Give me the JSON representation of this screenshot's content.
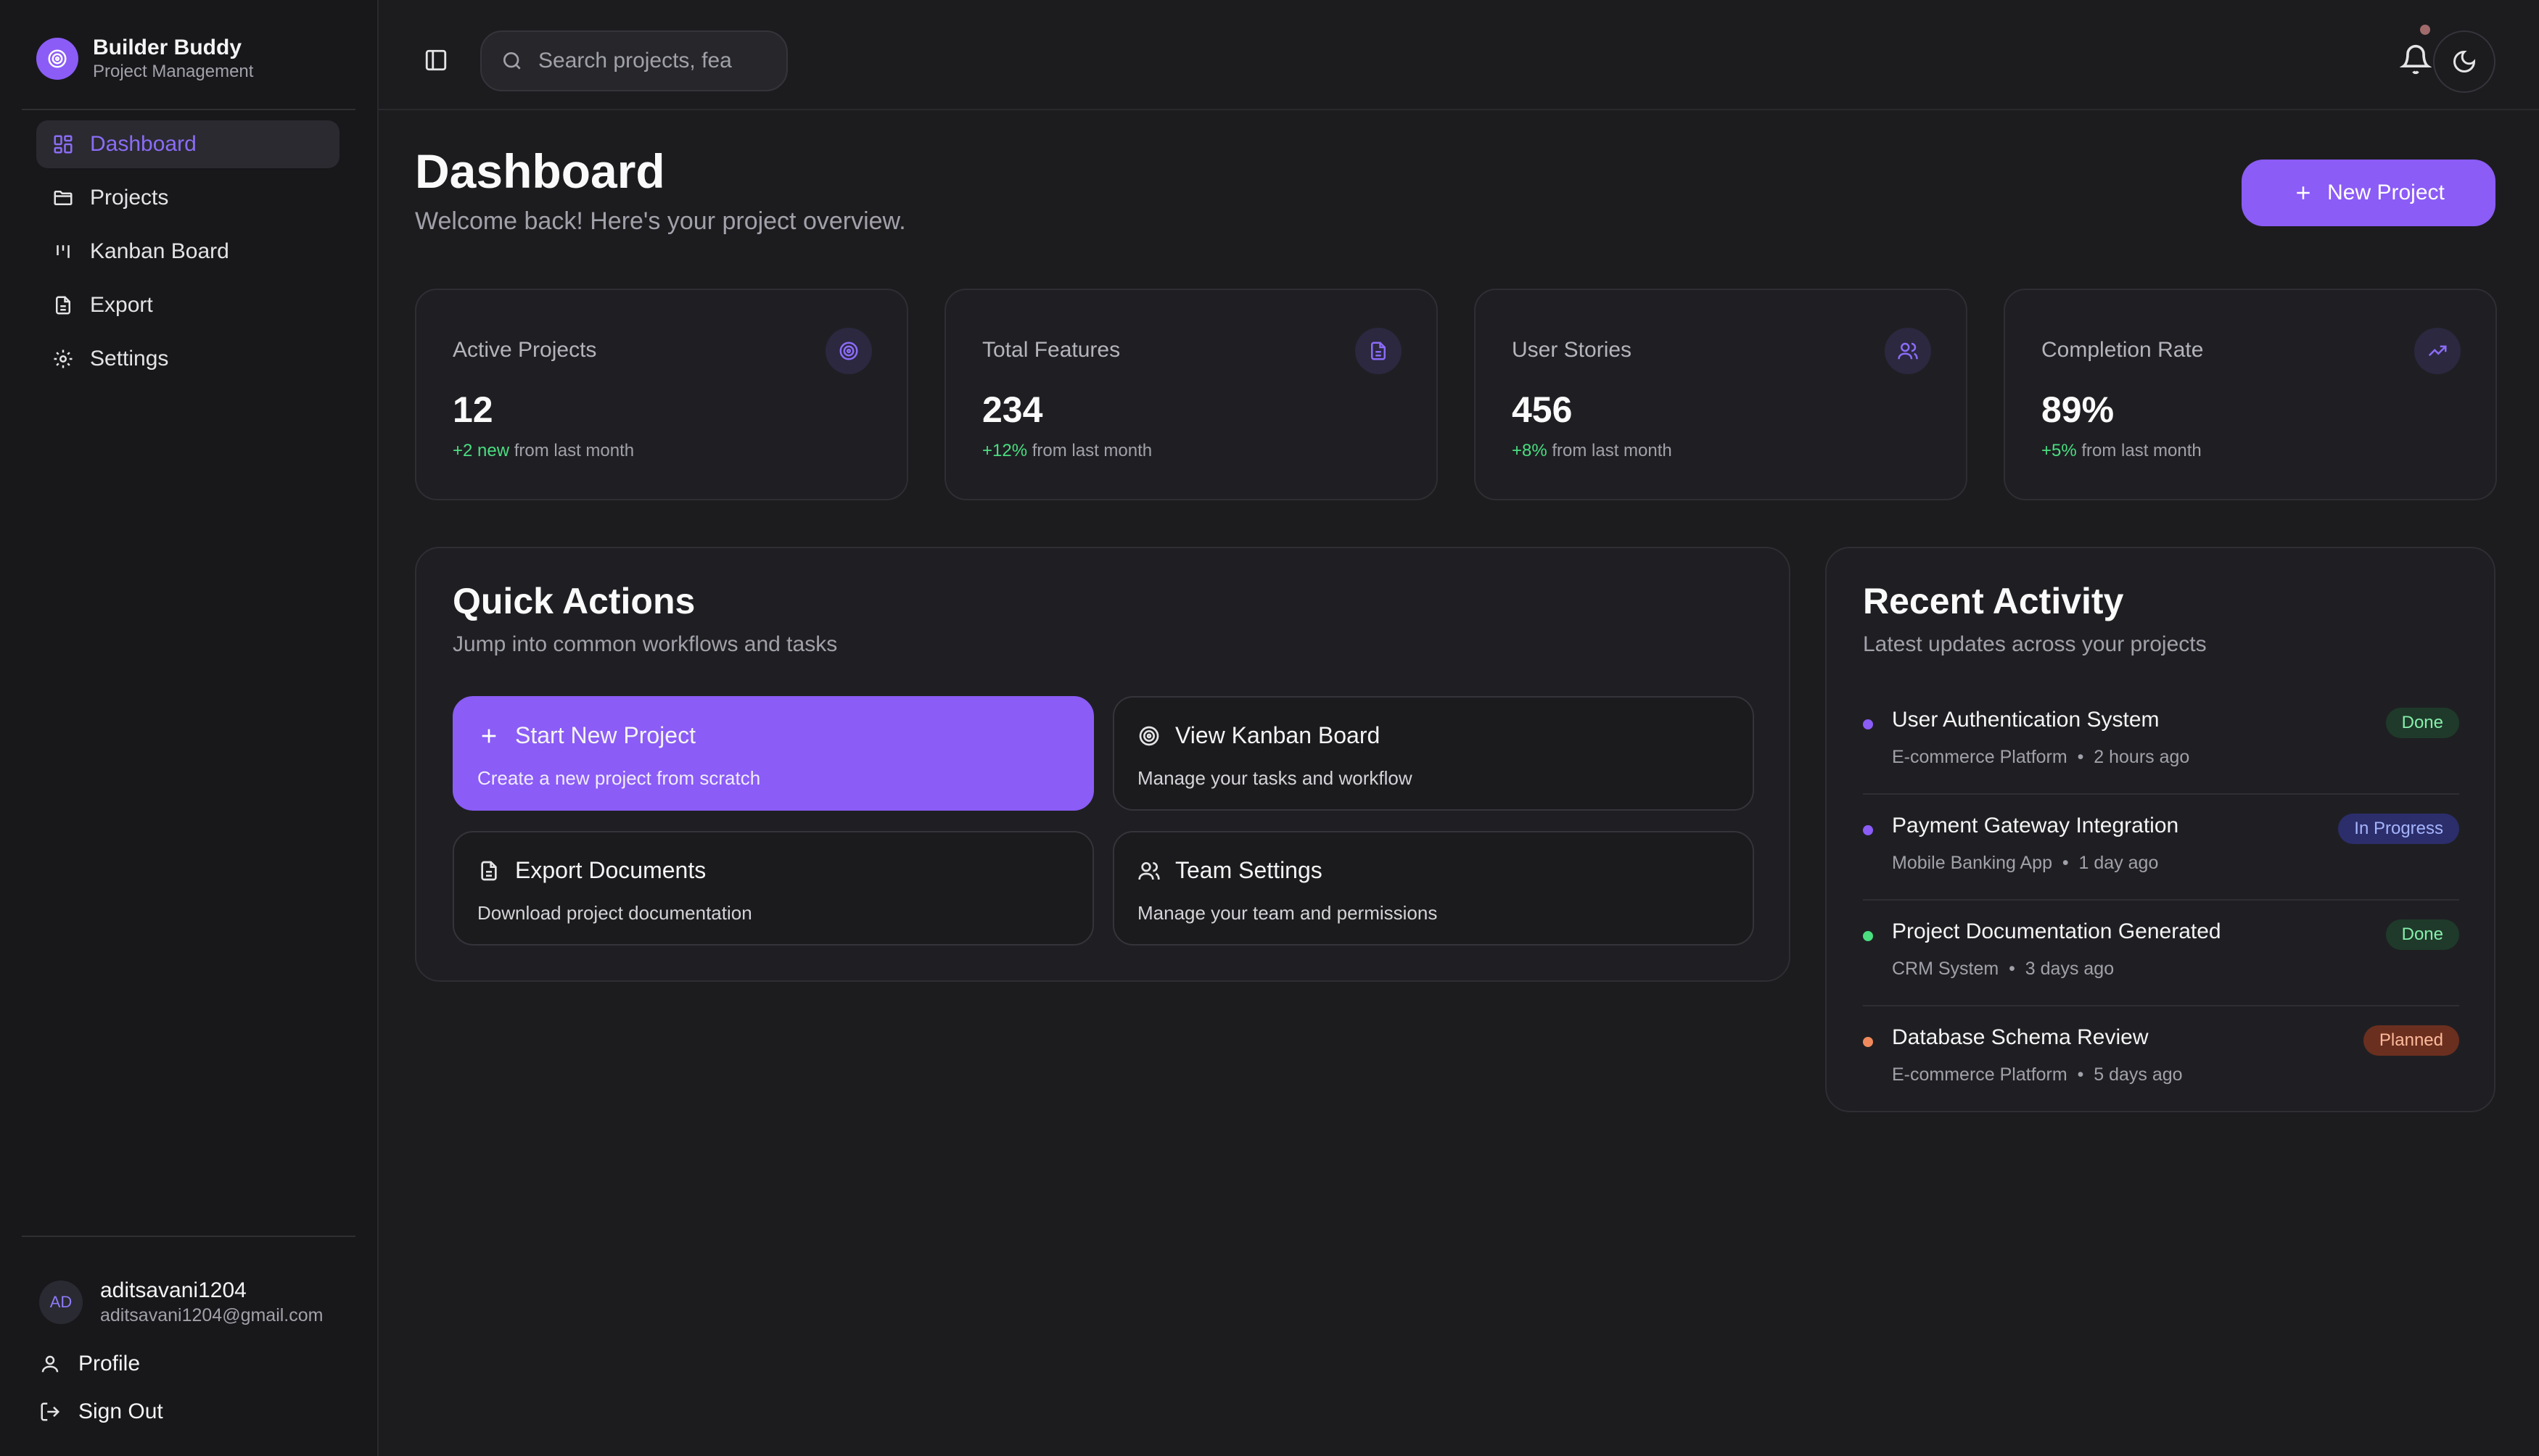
{
  "brand": {
    "name": "Builder Buddy",
    "subtitle": "Project Management"
  },
  "nav": [
    {
      "label": "Dashboard",
      "icon": "grid-icon",
      "active": true
    },
    {
      "label": "Projects",
      "icon": "folder-icon"
    },
    {
      "label": "Kanban Board",
      "icon": "kanban-icon"
    },
    {
      "label": "Export",
      "icon": "document-icon"
    },
    {
      "label": "Settings",
      "icon": "gear-icon"
    }
  ],
  "user": {
    "initials": "AD",
    "name": "aditsavani1204",
    "email": "aditsavani1204@gmail.com",
    "profile_label": "Profile",
    "signout_label": "Sign Out"
  },
  "search": {
    "placeholder": "Search projects, fea"
  },
  "page": {
    "title": "Dashboard",
    "subtitle": "Welcome back! Here's your project overview.",
    "new_project_label": "New Project"
  },
  "stats": [
    {
      "label": "Active Projects",
      "value": "12",
      "change": "+2 new",
      "suffix": " from last month",
      "icon": "target-icon"
    },
    {
      "label": "Total Features",
      "value": "234",
      "change": "+12%",
      "suffix": " from last month",
      "icon": "file-icon"
    },
    {
      "label": "User Stories",
      "value": "456",
      "change": "+8%",
      "suffix": " from last month",
      "icon": "users-icon"
    },
    {
      "label": "Completion Rate",
      "value": "89%",
      "change": "+5%",
      "suffix": " from last month",
      "icon": "trending-up-icon"
    }
  ],
  "quick_actions": {
    "title": "Quick Actions",
    "subtitle": "Jump into common workflows and tasks",
    "items": [
      {
        "title": "Start New Project",
        "desc": "Create a new project from scratch",
        "icon": "plus-icon"
      },
      {
        "title": "View Kanban Board",
        "desc": "Manage your tasks and workflow",
        "icon": "target-icon"
      },
      {
        "title": "Export Documents",
        "desc": "Download project documentation",
        "icon": "document-icon"
      },
      {
        "title": "Team Settings",
        "desc": "Manage your team and permissions",
        "icon": "users-icon"
      }
    ]
  },
  "recent_activity": {
    "title": "Recent Activity",
    "subtitle": "Latest updates across your projects",
    "items": [
      {
        "title": "User Authentication System",
        "project": "E-commerce Platform",
        "time": "2 hours ago",
        "status": "Done",
        "dot_color": "#8b5cf6"
      },
      {
        "title": "Payment Gateway Integration",
        "project": "Mobile Banking App",
        "time": "1 day ago",
        "status": "In Progress",
        "dot_color": "#8b5cf6"
      },
      {
        "title": "Project Documentation Generated",
        "project": "CRM System",
        "time": "3 days ago",
        "status": "Done",
        "dot_color": "#4ade80"
      },
      {
        "title": "Database Schema Review",
        "project": "E-commerce Platform",
        "time": "5 days ago",
        "status": "Planned",
        "dot_color": "#f08a5d"
      }
    ]
  },
  "colors": {
    "accent": "#8b5cf6",
    "background": "#1c1c1f",
    "positive": "#4ade80"
  }
}
